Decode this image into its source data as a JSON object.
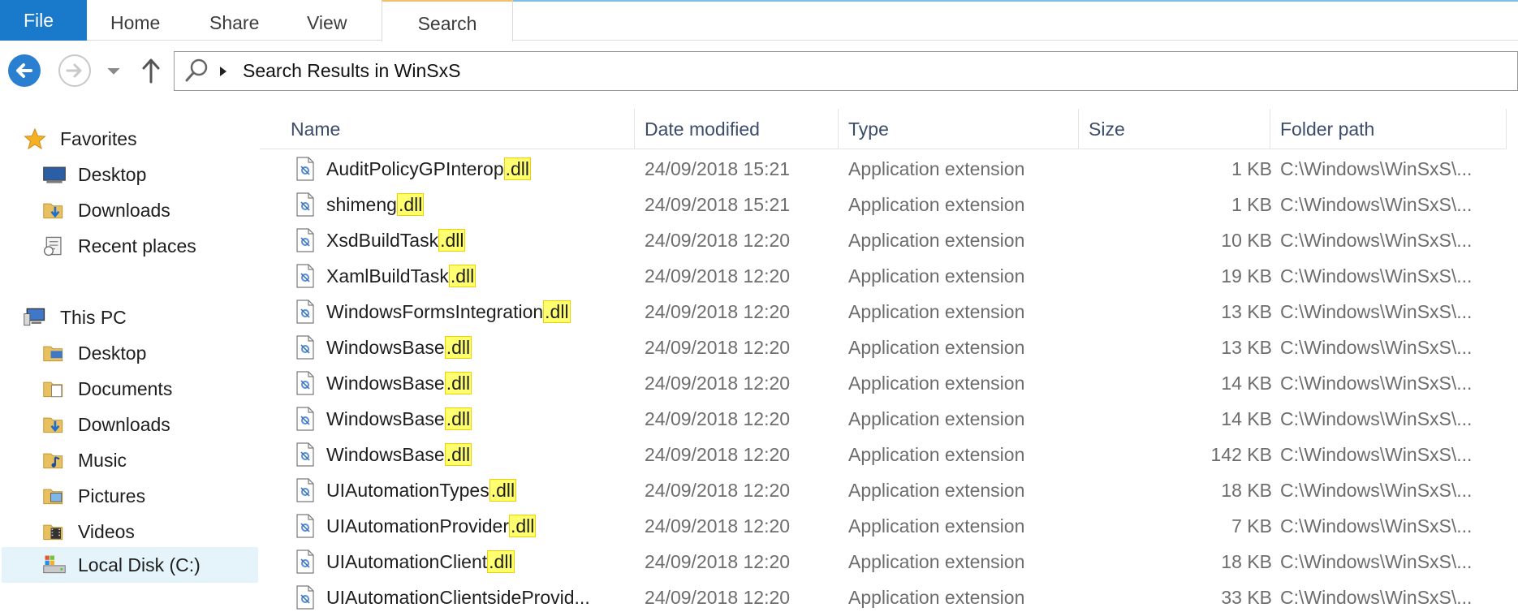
{
  "ribbon": {
    "file": "File",
    "tabs": [
      "Home",
      "Share",
      "View"
    ],
    "search_tab": "Search"
  },
  "address": {
    "crumb": "Search Results in WinSxS"
  },
  "sidebar": {
    "favorites": "Favorites",
    "fav_items": [
      "Desktop",
      "Downloads",
      "Recent places"
    ],
    "this_pc": "This PC",
    "pc_items": [
      "Desktop",
      "Documents",
      "Downloads",
      "Music",
      "Pictures",
      "Videos",
      "Local Disk (C:)"
    ],
    "selected": "Local Disk (C:)"
  },
  "columns": [
    "Name",
    "Date modified",
    "Type",
    "Size",
    "Folder path"
  ],
  "files": [
    {
      "base": "AuditPolicyGPInterop",
      "ext": ".dll",
      "date": "24/09/2018 15:21",
      "type": "Application extension",
      "size": "1 KB",
      "path": "C:\\Windows\\WinSxS\\..."
    },
    {
      "base": "shimeng",
      "ext": ".dll",
      "date": "24/09/2018 15:21",
      "type": "Application extension",
      "size": "1 KB",
      "path": "C:\\Windows\\WinSxS\\..."
    },
    {
      "base": "XsdBuildTask",
      "ext": ".dll",
      "date": "24/09/2018 12:20",
      "type": "Application extension",
      "size": "10 KB",
      "path": "C:\\Windows\\WinSxS\\..."
    },
    {
      "base": "XamlBuildTask",
      "ext": ".dll",
      "date": "24/09/2018 12:20",
      "type": "Application extension",
      "size": "19 KB",
      "path": "C:\\Windows\\WinSxS\\..."
    },
    {
      "base": "WindowsFormsIntegration",
      "ext": ".dll",
      "date": "24/09/2018 12:20",
      "type": "Application extension",
      "size": "13 KB",
      "path": "C:\\Windows\\WinSxS\\..."
    },
    {
      "base": "WindowsBase",
      "ext": ".dll",
      "date": "24/09/2018 12:20",
      "type": "Application extension",
      "size": "13 KB",
      "path": "C:\\Windows\\WinSxS\\..."
    },
    {
      "base": "WindowsBase",
      "ext": ".dll",
      "date": "24/09/2018 12:20",
      "type": "Application extension",
      "size": "14 KB",
      "path": "C:\\Windows\\WinSxS\\..."
    },
    {
      "base": "WindowsBase",
      "ext": ".dll",
      "date": "24/09/2018 12:20",
      "type": "Application extension",
      "size": "14 KB",
      "path": "C:\\Windows\\WinSxS\\..."
    },
    {
      "base": "WindowsBase",
      "ext": ".dll",
      "date": "24/09/2018 12:20",
      "type": "Application extension",
      "size": "142 KB",
      "path": "C:\\Windows\\WinSxS\\..."
    },
    {
      "base": "UIAutomationTypes",
      "ext": ".dll",
      "date": "24/09/2018 12:20",
      "type": "Application extension",
      "size": "18 KB",
      "path": "C:\\Windows\\WinSxS\\..."
    },
    {
      "base": "UIAutomationProvider",
      "ext": ".dll",
      "date": "24/09/2018 12:20",
      "type": "Application extension",
      "size": "7 KB",
      "path": "C:\\Windows\\WinSxS\\..."
    },
    {
      "base": "UIAutomationClient",
      "ext": ".dll",
      "date": "24/09/2018 12:20",
      "type": "Application extension",
      "size": "18 KB",
      "path": "C:\\Windows\\WinSxS\\..."
    },
    {
      "base": "UIAutomationClientsideProvid...",
      "ext": "",
      "date": "24/09/2018 12:20",
      "type": "Application extension",
      "size": "33 KB",
      "path": "C:\\Windows\\WinSxS\\..."
    }
  ],
  "colors": {
    "file_tab": "#1979ca",
    "highlight": "#ffff70",
    "back_button": "#2a7fd0",
    "selected_row": "#e5f3fb"
  }
}
